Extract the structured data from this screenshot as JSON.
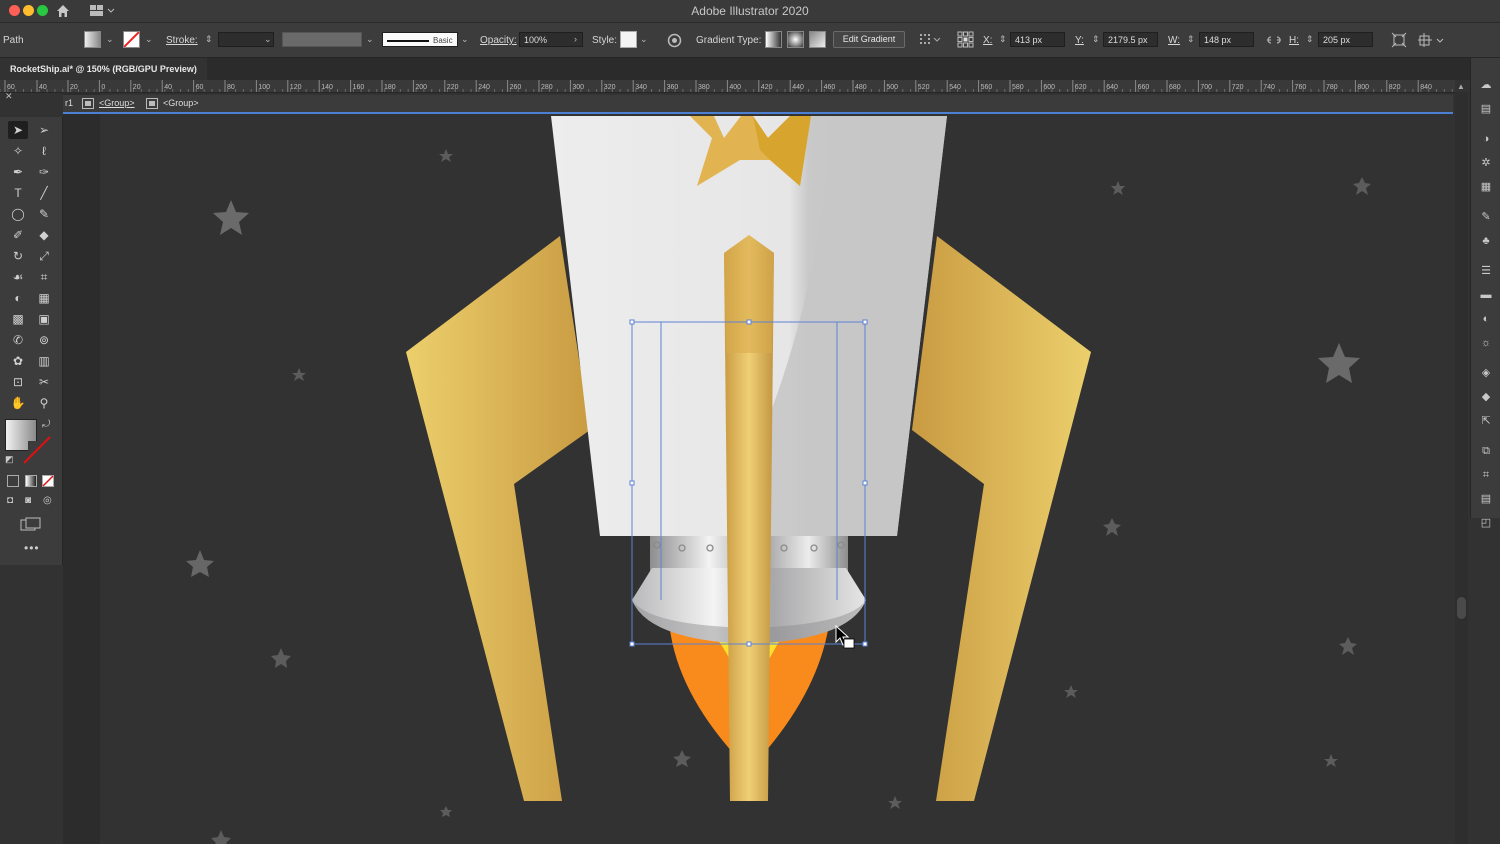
{
  "window": {
    "title": "Adobe Illustrator 2020"
  },
  "control_bar": {
    "selection_type": "Path",
    "stroke_label": "Stroke:",
    "stroke_profile": "Basic",
    "opacity_label": "Opacity:",
    "opacity_value": "100%",
    "style_label": "Style:",
    "gradient_type_label": "Gradient Type:",
    "edit_gradient_button": "Edit Gradient",
    "x_label": "X:",
    "x_value": "413 px",
    "y_label": "Y:",
    "y_value": "2179.5 px",
    "w_label": "W:",
    "w_value": "148 px",
    "h_label": "H:",
    "h_value": "205 px"
  },
  "document": {
    "tab_label": "RocketShip.ai* @ 150% (RGB/GPU Preview)",
    "artboard_crumb": "r1",
    "breadcrumbs": [
      "<Group>",
      "<Group>"
    ]
  },
  "ruler": {
    "left_ticks": [
      "60",
      "40"
    ],
    "ticks": [
      "20",
      "0",
      "20",
      "40",
      "60",
      "80",
      "100",
      "120",
      "140",
      "160",
      "180",
      "200",
      "220",
      "240",
      "260",
      "280",
      "300",
      "320",
      "340",
      "360",
      "380",
      "400",
      "420",
      "440",
      "460",
      "480",
      "500",
      "520",
      "540",
      "560",
      "580",
      "600",
      "620",
      "640",
      "660",
      "680",
      "700",
      "720",
      "740",
      "760",
      "780",
      "800",
      "820",
      "840"
    ]
  },
  "tools": [
    "selection-tool",
    "direct-selection-tool",
    "magic-wand-tool",
    "lasso-tool",
    "pen-tool",
    "curvature-tool",
    "type-tool",
    "line-segment-tool",
    "ellipse-tool",
    "paintbrush-tool",
    "shaper-tool",
    "eraser-tool",
    "rotate-tool",
    "scale-tool",
    "warp-tool",
    "free-transform-tool",
    "shape-builder-tool",
    "perspective-grid-tool",
    "mesh-tool",
    "gradient-tool",
    "eyedropper-tool",
    "blend-tool",
    "symbol-sprayer-tool",
    "column-graph-tool",
    "artboard-tool",
    "slice-tool",
    "hand-tool",
    "zoom-tool"
  ],
  "colors": {
    "fill_gradient_start": "#f0f0f0",
    "fill_gradient_end": "#8a8a8a",
    "selection_blue": "#4d7fd3",
    "rocket_gold": "#e2b451",
    "flame_orange": "#f98a1c",
    "canvas_bg": "#323232"
  },
  "right_panel_icons": [
    "libraries-icon",
    "properties-icon",
    "color-icon",
    "color-guide-icon",
    "swatches-icon",
    "brushes-icon",
    "symbols-icon",
    "stroke-icon",
    "gradient-icon",
    "transparency-icon",
    "appearance-icon",
    "graphic-styles-icon",
    "layers-icon",
    "asset-export-icon",
    "artboards-icon",
    "transform-icon",
    "align-icon",
    "pathfinder-icon"
  ]
}
